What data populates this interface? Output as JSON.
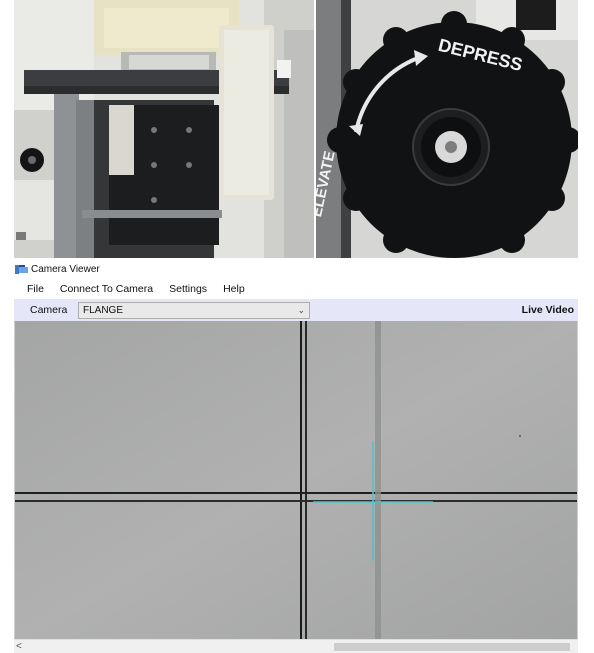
{
  "photos": {
    "knob_text_top": "DEPRESS",
    "knob_text_left": "ELEVATE"
  },
  "window": {
    "title": "Camera Viewer"
  },
  "menu": [
    "File",
    "Connect To Camera",
    "Settings",
    "Help"
  ],
  "camera_bar": {
    "label": "Camera",
    "selected": "FLANGE",
    "status": "Live Video"
  },
  "scrollbar": {
    "left_arrow": "<"
  },
  "icons": {
    "app": "camera-viewer-app-icon",
    "dropdown": "chevron-down-icon",
    "scroll_left": "scroll-left-arrow-icon"
  }
}
